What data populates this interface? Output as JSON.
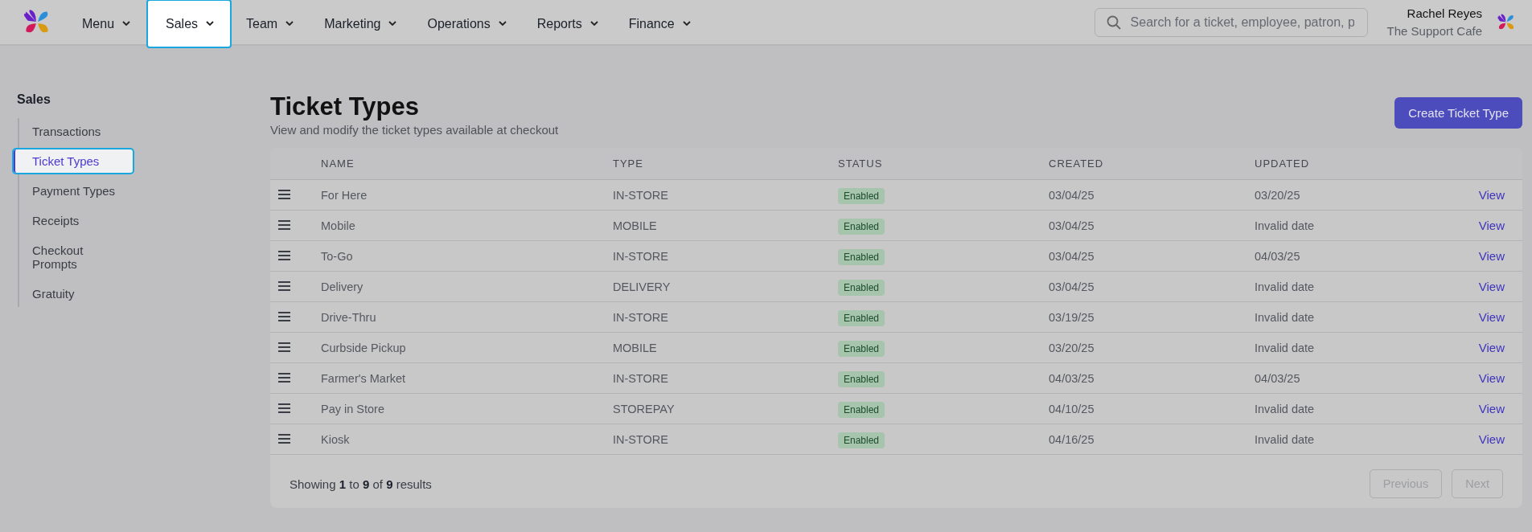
{
  "nav": {
    "items": [
      {
        "label": "Menu",
        "selected": false
      },
      {
        "label": "Sales",
        "selected": true
      },
      {
        "label": "Team",
        "selected": false
      },
      {
        "label": "Marketing",
        "selected": false
      },
      {
        "label": "Operations",
        "selected": false
      },
      {
        "label": "Reports",
        "selected": false
      },
      {
        "label": "Finance",
        "selected": false
      }
    ],
    "search": {
      "placeholder": "Search for a ticket, employee, patron, p"
    },
    "user": {
      "name": "Rachel Reyes",
      "org": "The Support Cafe"
    }
  },
  "sidebar": {
    "title": "Sales",
    "items": [
      {
        "label": "Transactions",
        "selected": false
      },
      {
        "label": "Ticket Types",
        "selected": true
      },
      {
        "label": "Payment Types",
        "selected": false
      },
      {
        "label": "Receipts",
        "selected": false
      },
      {
        "label": "Checkout Prompts",
        "selected": false
      },
      {
        "label": "Gratuity",
        "selected": false
      }
    ]
  },
  "page": {
    "title": "Ticket Types",
    "subtitle": "View and modify the ticket types available at checkout",
    "create_button": "Create Ticket Type"
  },
  "table": {
    "columns": [
      "NAME",
      "TYPE",
      "STATUS",
      "CREATED",
      "UPDATED"
    ],
    "rows": [
      {
        "name": "For Here",
        "type": "IN-STORE",
        "status": "Enabled",
        "created": "03/04/25",
        "updated": "03/20/25",
        "action": "View"
      },
      {
        "name": "Mobile",
        "type": "MOBILE",
        "status": "Enabled",
        "created": "03/04/25",
        "updated": "Invalid date",
        "action": "View"
      },
      {
        "name": "To-Go",
        "type": "IN-STORE",
        "status": "Enabled",
        "created": "03/04/25",
        "updated": "04/03/25",
        "action": "View"
      },
      {
        "name": "Delivery",
        "type": "DELIVERY",
        "status": "Enabled",
        "created": "03/04/25",
        "updated": "Invalid date",
        "action": "View"
      },
      {
        "name": "Drive-Thru",
        "type": "IN-STORE",
        "status": "Enabled",
        "created": "03/19/25",
        "updated": "Invalid date",
        "action": "View"
      },
      {
        "name": "Curbside Pickup",
        "type": "MOBILE",
        "status": "Enabled",
        "created": "03/20/25",
        "updated": "Invalid date",
        "action": "View"
      },
      {
        "name": "Farmer's Market",
        "type": "IN-STORE",
        "status": "Enabled",
        "created": "04/03/25",
        "updated": "04/03/25",
        "action": "View"
      },
      {
        "name": "Pay in Store",
        "type": "STOREPAY",
        "status": "Enabled",
        "created": "04/10/25",
        "updated": "Invalid date",
        "action": "View"
      },
      {
        "name": "Kiosk",
        "type": "IN-STORE",
        "status": "Enabled",
        "created": "04/16/25",
        "updated": "Invalid date",
        "action": "View"
      }
    ],
    "summary": "Showing **1** to **9** of **9** results",
    "pagination": [
      {
        "label": "Previous",
        "disabled": true
      },
      {
        "label": "Next",
        "disabled": true
      }
    ]
  }
}
